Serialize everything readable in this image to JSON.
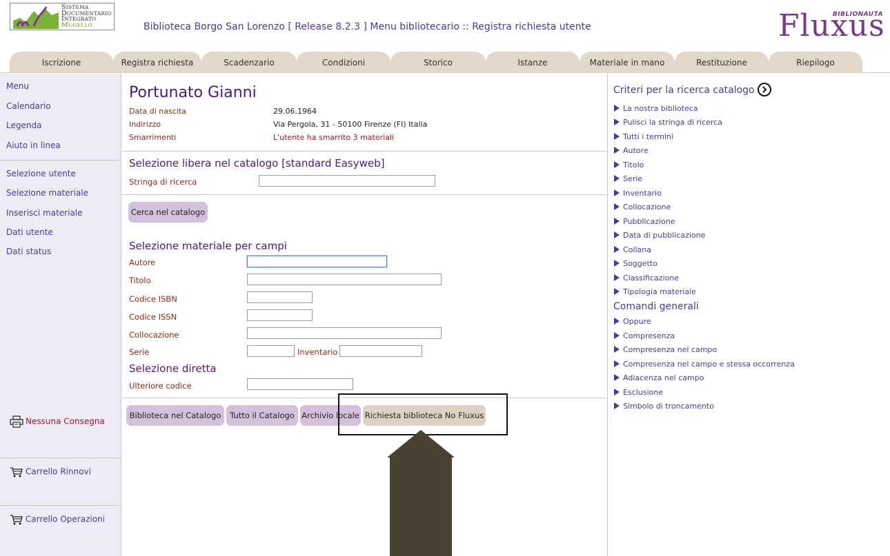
{
  "header": {
    "logo_lines": [
      "Sistema",
      "Documentario",
      "Integrato",
      "Mugello"
    ],
    "title": "Biblioteca Borgo San Lorenzo [ Release 8.2.3 ] Menu bibliotecario :: Registra richiesta utente",
    "brand_sub": "BIBLIONAUTA",
    "brand_main": "Fluxus"
  },
  "tabs": [
    {
      "label": "Iscrizione"
    },
    {
      "label": "Registra richiesta"
    },
    {
      "label": "Scadenzario"
    },
    {
      "label": "Condizioni"
    },
    {
      "label": "Storico"
    },
    {
      "label": "Istanze"
    },
    {
      "label": "Materiale in mano"
    },
    {
      "label": "Restituzione"
    },
    {
      "label": "Riepilogo"
    }
  ],
  "sidebar": {
    "top_items": [
      {
        "label": "Menu"
      },
      {
        "label": "Calendario"
      },
      {
        "label": "Legenda"
      },
      {
        "label": "Aiuto in linea"
      }
    ],
    "items": [
      {
        "label": "Selezione utente"
      },
      {
        "label": "Selezione materiale"
      },
      {
        "label": "Inserisci materiale"
      },
      {
        "label": "Dati utente"
      },
      {
        "label": "Dati status"
      }
    ],
    "actions": {
      "no_delivery": "Nessuna Consegna",
      "renew_cart": "Carrello Rinnovi",
      "operations_cart": "Carrello Operazioni"
    }
  },
  "user": {
    "name": "Portunato Gianni",
    "birth_label": "Data di nascita",
    "birth_value": "29.06.1964",
    "address_label": "Indirizzo",
    "address_value": "Via Pergola, 31 - 50100 Firenze (FI) Italia",
    "lost_label": "Smarrimenti",
    "lost_value": "L'utente ha smarrito 3 materiali"
  },
  "free_search": {
    "title": "Selezione libera nel catalogo [standard Easyweb]",
    "string_label": "Stringa di ricerca",
    "string_value": "",
    "search_button": "Cerca nel catalogo"
  },
  "field_search": {
    "title": "Selezione materiale per campi",
    "author_label": "Autore",
    "title_label": "Titolo",
    "isbn_label": "Codice ISBN",
    "issn_label": "Codice ISSN",
    "location_label": "Collocazione",
    "series_label": "Serie",
    "inventory_label": "Inventario"
  },
  "direct": {
    "title": "Selezione diretta",
    "code_label": "Ulteriore codice"
  },
  "buttons": {
    "library_catalog": "Biblioteca nel Catalogo",
    "all_catalog": "Tutto il Catalogo",
    "local_archive": "Archivio locale",
    "no_fluxus": "Richiesta biblioteca No Fluxus"
  },
  "right": {
    "criteria_title": "Criteri per la ricerca catalogo",
    "criteria": [
      "La nostra biblioteca",
      "Pulisci la stringa di ricerca",
      "Tutti i termini",
      "Autore",
      "Titolo",
      "Serie",
      "Inventario",
      "Collocazione",
      "Pubblicazione",
      "Data di pubblicazione",
      "Collana",
      "Soggetto",
      "Classificazione",
      "Tipologia materiale"
    ],
    "commands_title": "Comandi generali",
    "commands": [
      "Oppure",
      "Compresenza",
      "Compresenza nel campo",
      "Compresenza nel campo e stessa occorrenza",
      "Adiacenza nel campo",
      "Esclusione",
      "Simbolo di troncamento"
    ]
  },
  "colors": {
    "accent": "#4a3a9a",
    "brand": "#7a3a8a",
    "label": "#8a2a1a",
    "tab_bg": "#e1d8ca",
    "button_bg": "#d4c0da",
    "sidebar_bg": "#efebf5",
    "annotation_arrow": "#4a4230"
  }
}
